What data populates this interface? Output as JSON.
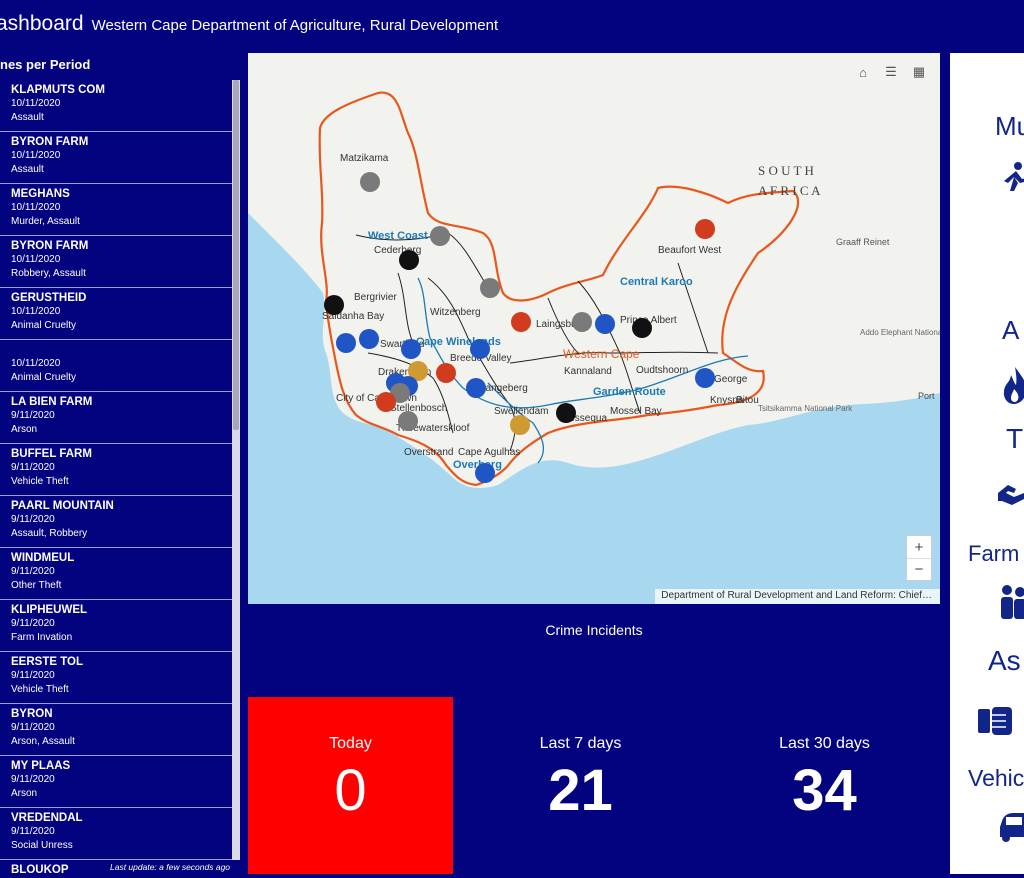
{
  "header": {
    "app_title": "ashboard",
    "org_title": "Western Cape Department of Agriculture, Rural Development"
  },
  "list": {
    "title": "nes per Period",
    "items": [
      {
        "name": "KLAPMUTS COM",
        "date": "10/11/2020",
        "type": "Assault"
      },
      {
        "name": "BYRON FARM",
        "date": "10/11/2020",
        "type": "Assault"
      },
      {
        "name": "MEGHANS",
        "date": "10/11/2020",
        "type": "Murder, Assault"
      },
      {
        "name": "BYRON FARM",
        "date": "10/11/2020",
        "type": "Robbery, Assault"
      },
      {
        "name": "GERUSTHEID",
        "date": "10/11/2020",
        "type": "Animal Cruelty"
      },
      {
        "name": "",
        "date": "10/11/2020",
        "type": "Animal Cruelty"
      },
      {
        "name": "LA BIEN FARM",
        "date": "9/11/2020",
        "type": "Arson"
      },
      {
        "name": "BUFFEL FARM",
        "date": "9/11/2020",
        "type": "Vehicle Theft"
      },
      {
        "name": "PAARL MOUNTAIN",
        "date": "9/11/2020",
        "type": "Assault, Robbery"
      },
      {
        "name": "WINDMEUL",
        "date": "9/11/2020",
        "type": "Other Theft"
      },
      {
        "name": "KLIPHEUWEL",
        "date": "9/11/2020",
        "type": "Farm Invation"
      },
      {
        "name": "EERSTE TOL",
        "date": "9/11/2020",
        "type": "Vehicle Theft"
      },
      {
        "name": "BYRON",
        "date": "9/11/2020",
        "type": "Arson, Assault"
      },
      {
        "name": "MY PLAAS",
        "date": "9/11/2020",
        "type": "Arson"
      },
      {
        "name": "VREDENDAL",
        "date": "9/11/2020",
        "type": "Social Unress"
      },
      {
        "name": "BLOUKOP",
        "date": "",
        "type": ""
      }
    ],
    "last_update": "Last update: a few seconds ago"
  },
  "map": {
    "attribution": "Department of Rural Development and Land Reform: Chief…",
    "zoom_in": "+",
    "zoom_out": "−",
    "country_line1": "S O U T H",
    "country_line2": "A F R I C A",
    "province": "Western Cape",
    "districts": [
      "West Coast",
      "Cape Winelands",
      "Central Karoo",
      "Garden Route",
      "Overberg"
    ],
    "places": [
      "Matzikama",
      "Cederberg",
      "Bergrivier",
      "Saldanha Bay",
      "Swartland",
      "Witzenberg",
      "Drakenstein",
      "Breede Valley",
      "Langeberg",
      "Stellenbosch",
      "City of Cape Town",
      "Theewaterskloof",
      "Swellendam",
      "Overstrand",
      "Cape Agulhas",
      "Hessequa",
      "Mossel Bay",
      "George",
      "Knysna",
      "Bitou",
      "Oudtshoorn",
      "Kannaland",
      "Prince Albert",
      "Laingsburg",
      "Beaufort West",
      "Graaff Reinet",
      "Addo Elephant National Park",
      "Tsitsikamma National Park",
      "Port"
    ]
  },
  "gauges": {
    "title": "Crime Incidents",
    "today_label": "Today",
    "today_value": "0",
    "week_label": "Last 7 days",
    "week_value": "21",
    "month_label": "Last 30 days",
    "month_value": "34"
  },
  "categories": {
    "murder": "Mu",
    "arson": "A",
    "theft": "T",
    "farm_invasion": "Farm",
    "assault": "As",
    "vehicle": "Vehic"
  },
  "colors": {
    "background": "#03037f",
    "today_bg": "#ff0000",
    "province_border": "#e8581c",
    "district_text": "#1b7ab5",
    "marker_blue": "#1f55c4",
    "marker_red": "#d23c1e",
    "marker_grey": "#7a7a7a",
    "category_icon": "#12268a"
  }
}
